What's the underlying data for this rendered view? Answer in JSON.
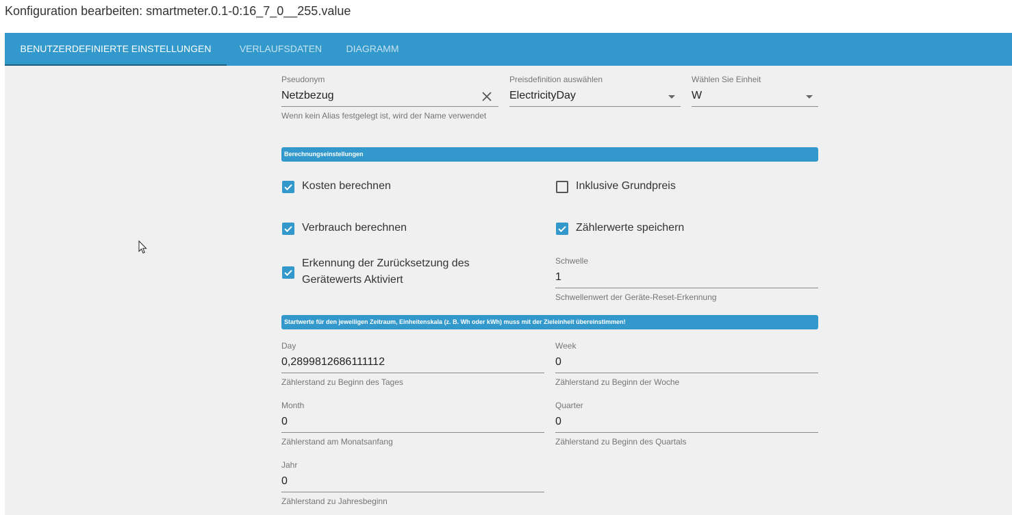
{
  "window": {
    "title": "Konfiguration bearbeiten: smartmeter.0.1-0:16_7_0__255.value"
  },
  "tabs": [
    {
      "label": "Benutzerdefinierte Einstellungen"
    },
    {
      "label": "Verlaufsdaten"
    },
    {
      "label": "Diagramm"
    }
  ],
  "form": {
    "alias": {
      "label": "Pseudonym",
      "value": "Netzbezug",
      "help": "Wenn kein Alias festgelegt ist, wird der Name verwendet"
    },
    "price": {
      "label": "Preisdefinition auswählen",
      "value": "ElectricityDay"
    },
    "unit": {
      "label": "Wählen Sie Einheit",
      "value": "W"
    },
    "calc_section": "Berechnungseinstellungen",
    "checkboxes": {
      "calc_cost": {
        "label": "Kosten berechnen",
        "checked": true
      },
      "basic_price": {
        "label": "Inklusive Grundpreis",
        "checked": false
      },
      "calc_consumption": {
        "label": "Verbrauch berechnen",
        "checked": true
      },
      "save_meter": {
        "label": "Zählerwerte speichern",
        "checked": true
      },
      "reset_detect": {
        "label": "Erkennung der Zurücksetzung des Gerätewerts Aktiviert",
        "checked": true
      }
    },
    "threshold": {
      "label": "Schwelle",
      "value": "1",
      "help": "Schwellenwert der Geräte-Reset-Erkennung"
    },
    "start_section": "Startwerte für den jeweiligen Zeitraum, Einheitenskala (z. B. Wh oder kWh) muss mit der Zieleinheit übereinstimmen!",
    "day": {
      "label": "Day",
      "value": "0,2899812686111112",
      "help": "Zählerstand zu Beginn des Tages"
    },
    "week": {
      "label": "Week",
      "value": "0",
      "help": "Zählerstand zu Beginn der Woche"
    },
    "month": {
      "label": "Month",
      "value": "0",
      "help": "Zählerstand am Monatsanfang"
    },
    "quarter": {
      "label": "Quarter",
      "value": "0",
      "help": "Zählerstand zu Beginn des Quartals"
    },
    "year": {
      "label": "Jahr",
      "value": "0",
      "help": "Zählerstand zu Jahresbeginn"
    }
  },
  "colors": {
    "accent": "#3399cc",
    "background": "#f0f0f0"
  },
  "icons": [
    "clear-icon",
    "dropdown-caret-icon",
    "checkbox-checked-icon",
    "checkbox-unchecked-icon",
    "mouse-cursor-icon"
  ]
}
